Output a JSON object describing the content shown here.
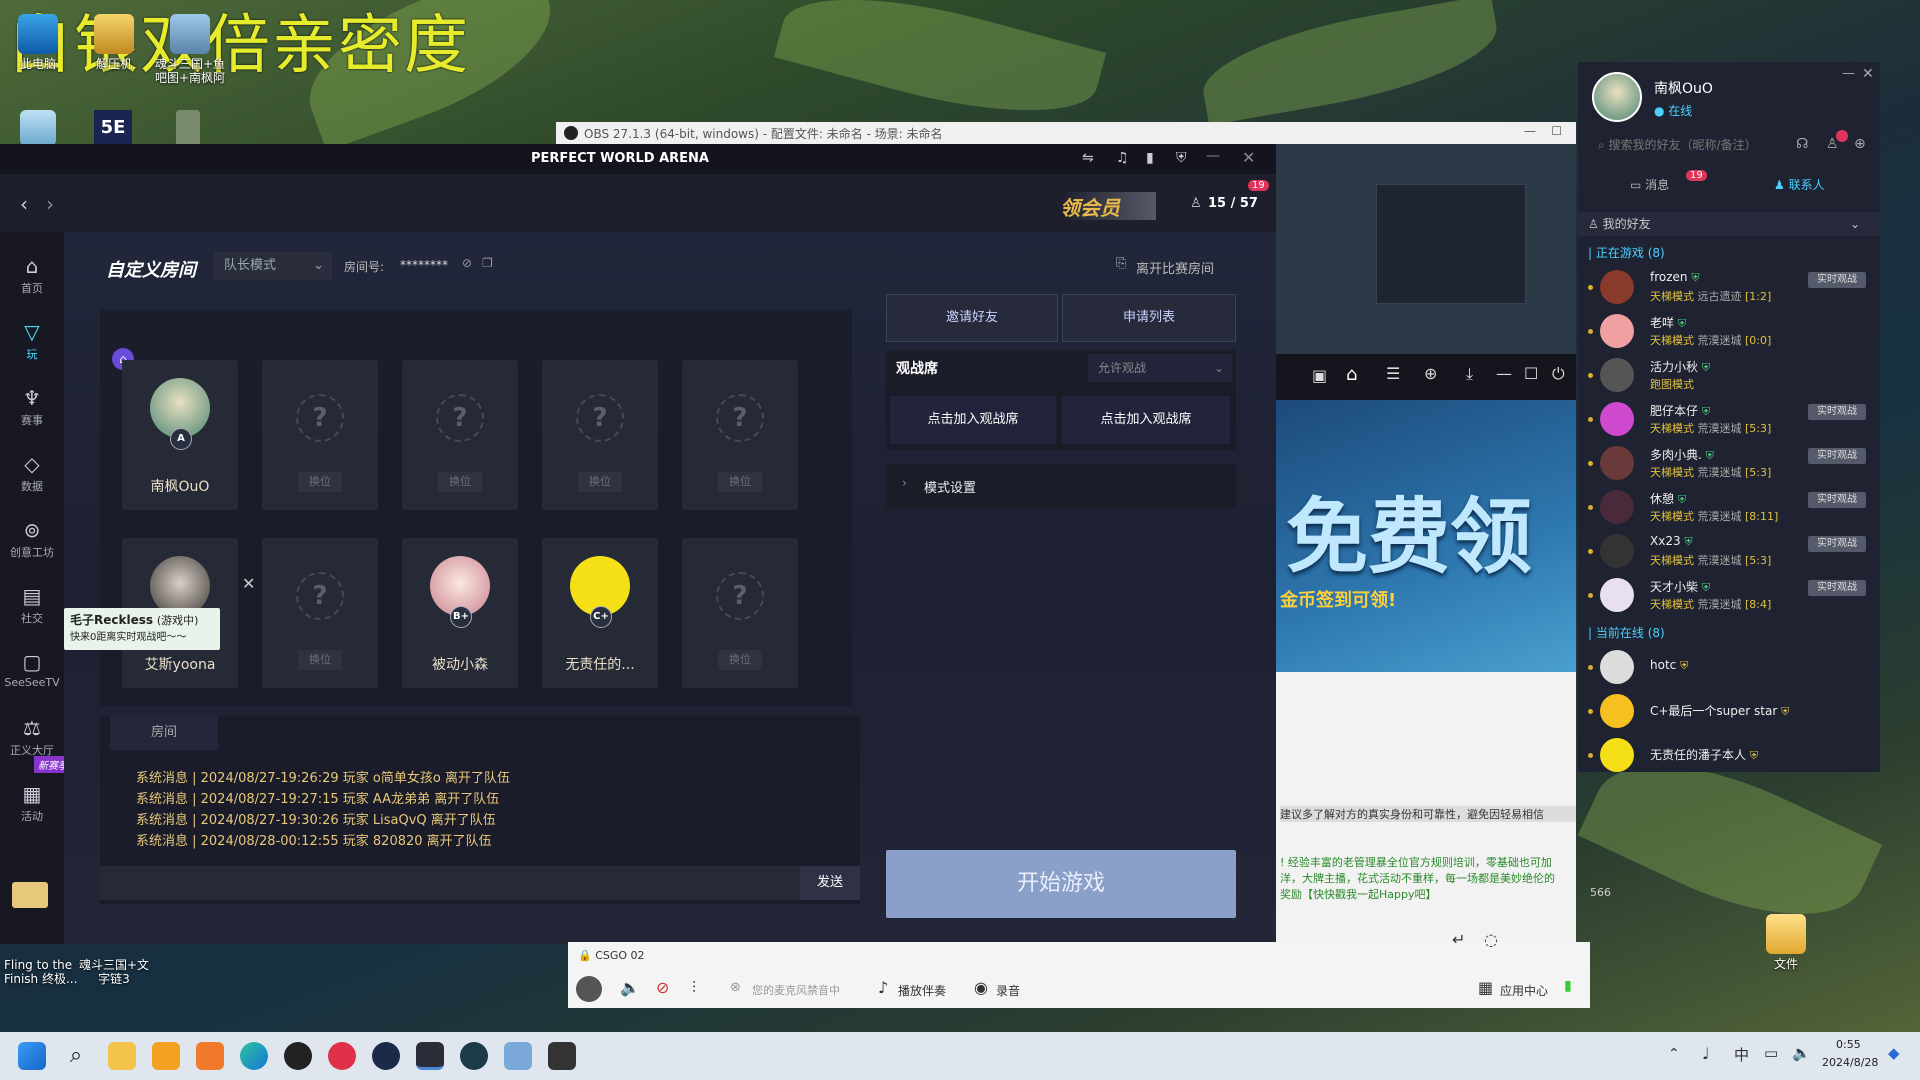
{
  "overlay_text": "白银双倍亲密度",
  "desktop": {
    "icons": [
      {
        "label": "此电脑"
      },
      {
        "label": "解压机"
      },
      {
        "label": "魂斗三国+鱼吧图+南枫阿"
      }
    ],
    "bottom_icons": [
      {
        "label": "Fling to the Finish 终极..."
      },
      {
        "label": "魂斗三国+文字链3"
      }
    ],
    "right_icon": "文件"
  },
  "obs": {
    "title": "OBS 27.1.3 (64-bit, windows) - 配置文件: 未命名 - 场景: 未命名"
  },
  "client": {
    "title": "PERFECT WORLD ARENA",
    "vip_badge": "领会员",
    "online_count": "15 / 57",
    "notify_count": "19",
    "room_type": "自定义房间",
    "mode": "队长模式",
    "room_no_label": "房间号:",
    "room_no": "********",
    "leave": "离开比赛房间",
    "nav": [
      {
        "label": "首页"
      },
      {
        "label": "玩"
      },
      {
        "label": "赛事"
      },
      {
        "label": "数据"
      },
      {
        "label": "创意工坊"
      },
      {
        "label": "社交"
      },
      {
        "label": "SeeSeeTV"
      },
      {
        "label": "正义大厅"
      },
      {
        "label": "活动"
      }
    ],
    "new_season_tag": "新赛季福利",
    "slots_row1": [
      {
        "name": "南枫OuO",
        "rank": "A"
      },
      {
        "swap": "换位"
      },
      {
        "swap": "换位"
      },
      {
        "swap": "换位"
      },
      {
        "swap": "换位"
      }
    ],
    "slots_row2": [
      {
        "name": "艾斯yoona"
      },
      {
        "swap": "换位"
      },
      {
        "name": "被动小森",
        "rank": "B+"
      },
      {
        "name": "无责任的...",
        "rank": "C+"
      },
      {
        "swap": "换位"
      }
    ],
    "tooltip": {
      "name": "毛子Reckless",
      "status": "(游戏中)",
      "hint": "快来0距离实时观战吧～～"
    },
    "invite": "邀请好友",
    "apply_list": "申请列表",
    "spectate": "观战席",
    "allow_spectate": "允许观战",
    "join_spectate_1": "点击加入观战席",
    "join_spectate_2": "点击加入观战席",
    "mode_settings": "模式设置",
    "chat_tab": "房间",
    "chat_lines": [
      "系统消息 | 2024/08/27-19:26:29 玩家 o简单女孩o 离开了队伍",
      "系统消息 | 2024/08/27-19:27:15 玩家 AA龙弟弟 离开了队伍",
      "系统消息 | 2024/08/27-19:30:26 玩家 LisaQvQ 离开了队伍",
      "系统消息 | 2024/08/28-00:12:55 玩家 820820 离开了队伍"
    ],
    "send": "发送",
    "start": "开始游戏"
  },
  "promo": {
    "big": "免费领",
    "sub": "金币签到可领!"
  },
  "web": {
    "line1": "建议多了解对方的真实身份和可靠性，避免因轻易相信",
    "line2": "! 经验丰富的老管理暴全位官方规则培训，零基础也可加",
    "line3": "洋，大牌主播，花式活动不重样，每一场都是美妙绝伦的",
    "line4": "奖励【快快戳我一起Happy吧】",
    "counter": "566"
  },
  "friends": {
    "user": "南枫OuO",
    "status": "在线",
    "search_placeholder": "搜索我的好友（昵称/备注）",
    "msg_tab": "消息",
    "msg_count": "19",
    "contact_tab": "联系人",
    "my_friends": "我的好友",
    "in_game_header": "正在游戏",
    "in_game_count": "(8)",
    "online_header": "当前在线",
    "online_count": "(8)",
    "watch_label": "实时观战",
    "in_game": [
      {
        "name": "frozen",
        "mode": "天梯模式",
        "map": "远古遗迹",
        "score": "[1:2]"
      },
      {
        "name": "老咩",
        "mode": "天梯模式",
        "map": "荒漠迷城",
        "score": "[0:0]"
      },
      {
        "name": "活力小秋",
        "mode": "跑图模式",
        "map": "",
        "score": ""
      },
      {
        "name": "肥仔本仔",
        "mode": "天梯模式",
        "map": "荒漠迷城",
        "score": "[5:3]"
      },
      {
        "name": "多肉小典.",
        "mode": "天梯模式",
        "map": "荒漠迷城",
        "score": "[5:3]"
      },
      {
        "name": "休憩",
        "mode": "天梯模式",
        "map": "荒漠迷城",
        "score": "[8:11]"
      },
      {
        "name": "Xx23",
        "mode": "天梯模式",
        "map": "荒漠迷城",
        "score": "[5:3]"
      },
      {
        "name": "天才小柴",
        "mode": "天梯模式",
        "map": "荒漠迷城",
        "score": "[8:4]"
      }
    ],
    "online": [
      {
        "name": "hotc"
      },
      {
        "name": "C+最后一个super star"
      },
      {
        "name": "无责任的潘子本人"
      }
    ]
  },
  "voice": {
    "channel": "CSGO 02",
    "mic_hint": "您的麦克风禁音中",
    "accompany": "播放伴奏",
    "record": "录音",
    "app_center": "应用中心"
  },
  "taskbar": {
    "time": "0:55",
    "date": "2024/8/28",
    "ime": "中"
  }
}
